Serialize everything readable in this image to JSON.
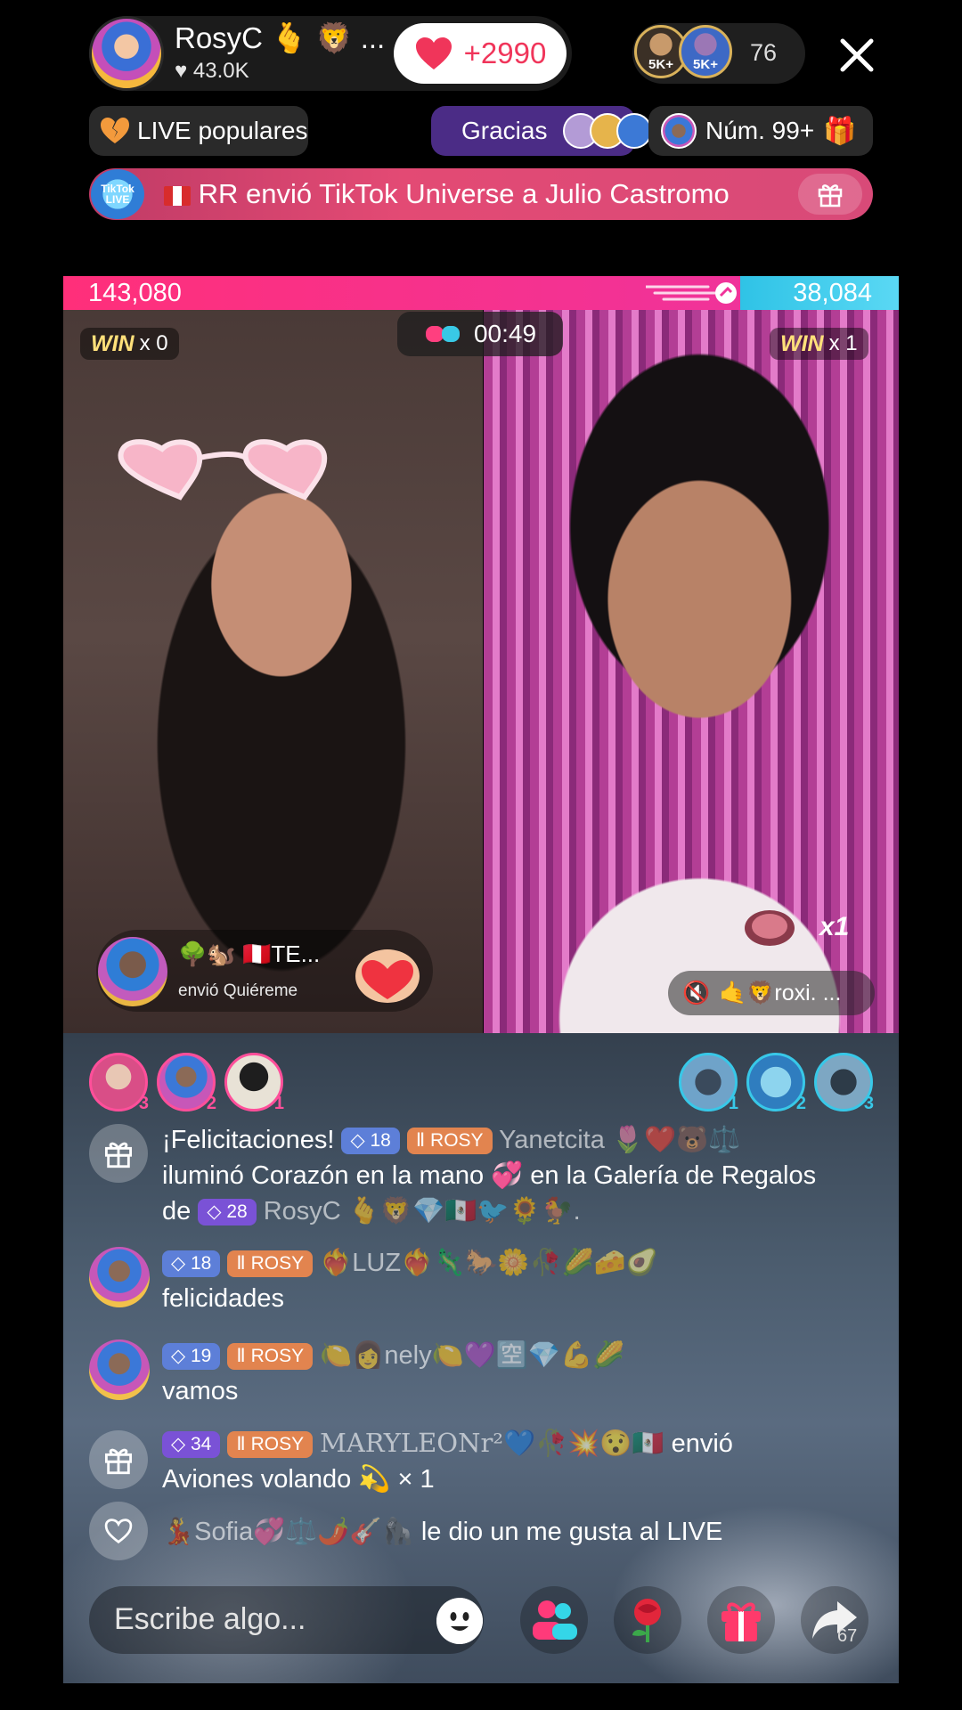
{
  "header": {
    "host_name": "RosyC 🫰 🦁 ...",
    "host_likes": "43.0K",
    "like_count": "+2990",
    "viewer_badges": [
      "5K+",
      "5K+"
    ],
    "viewer_count": "76"
  },
  "pills": {
    "popular": "LIVE populares",
    "gracias": "Gracias",
    "rank": "Núm. 99+"
  },
  "banner": {
    "badge": "TikTok LIVE",
    "text": "RR envió TikTok Universe a Julio Castromo"
  },
  "battle": {
    "left_score": "143,080",
    "right_score": "38,084",
    "timer": "00:49",
    "win_label": "WIN",
    "left_wins": "x 0",
    "right_wins": "x 1",
    "sender_name": "🌳🐿️ 🇵🇪TE...",
    "sender_action": "envió Quiéreme",
    "multiplier": "x1",
    "guest_name": "🤙🦁roxi. ..."
  },
  "rankings": {
    "left": [
      "3",
      "2",
      "1"
    ],
    "right": [
      "1",
      "2",
      "3"
    ]
  },
  "chat": [
    {
      "type": "gift",
      "line1_prefix": "¡Felicitaciones!",
      "level": "18",
      "team": "ROSY",
      "user": "Yanetcita 🌷❤️🐻⚖️",
      "line2": "iluminó Corazón en la mano 💞 en la Galería de Regalos",
      "line3_prefix": "de",
      "level2": "28",
      "user2": "RosyC 🫰🦁💎🇲🇽🐦🌻🐓."
    },
    {
      "type": "comment",
      "level": "18",
      "team": "ROSY",
      "user": "❤️‍🔥LUZ❤️‍🔥🦎🐎🌼🥀🌽🧀🥑",
      "text": "felicidades"
    },
    {
      "type": "comment",
      "level": "19",
      "team": "ROSY",
      "user": "🍋👩nely🍋💜🈳💎💪🌽",
      "text": "vamos"
    },
    {
      "type": "gift",
      "level": "34",
      "team": "ROSY",
      "user": "MARYLEONr²💙🥀💥😯🇲🇽",
      "action": "envió",
      "text": "Aviones volando 💫 × 1"
    },
    {
      "type": "like",
      "user": "💃Sofia💞⚖️🌶️🎸🦍",
      "text": "le dio un me gusta al LIVE"
    }
  ],
  "bottom": {
    "placeholder": "Escribe algo...",
    "share_count": "67"
  },
  "colors": {
    "score_left": "#ff2f7a",
    "score_right": "#2fc3e6",
    "like_red": "#f0355a",
    "gracias_purple": "#4b2c86"
  }
}
